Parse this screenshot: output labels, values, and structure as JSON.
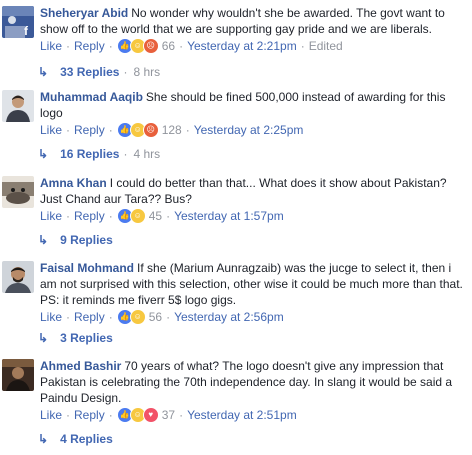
{
  "comments": [
    {
      "author": "Sheheryar Abid",
      "text": "No wonder why wouldn't she be awarded. The govt want to show off to the world that we are supporting gay pride and we are liberals.",
      "like": "Like",
      "reply": "Reply",
      "reaction_count": "66",
      "timestamp": "Yesterday at 2:21pm",
      "edited": "Edited",
      "replies": "33 Replies",
      "replies_time": "8 hrs"
    },
    {
      "author": "Muhammad Aaqib",
      "text": "She should be fined 500,000 instead of awarding for this logo",
      "like": "Like",
      "reply": "Reply",
      "reaction_count": "128",
      "timestamp": "Yesterday at 2:25pm",
      "replies": "16 Replies",
      "replies_time": "4 hrs"
    },
    {
      "author": "Amna Khan",
      "text": "I could do better than that... What does it show about Pakistan? Just Chand aur Tara?? Bus?",
      "like": "Like",
      "reply": "Reply",
      "reaction_count": "45",
      "timestamp": "Yesterday at 1:57pm",
      "replies": "9 Replies"
    },
    {
      "author": "Faisal Mohmand",
      "text": "If she (Marium Aunragzaib) was the jucge to select it, then i am not surprised with this selection, other wise it could be much more than that. PS: it reminds me fiverr 5$ logo gigs.",
      "like": "Like",
      "reply": "Reply",
      "reaction_count": "56",
      "timestamp": "Yesterday at 2:56pm",
      "replies": "3 Replies"
    },
    {
      "author": "Ahmed Bashir",
      "text": "70 years of what? The logo doesn't give any impression that Pakistan is celebrating the 70th independence day. In slang it would be said a Paindu Design.",
      "like": "Like",
      "reply": "Reply",
      "reaction_count": "37",
      "timestamp": "Yesterday at 2:51pm",
      "replies": "4 Replies"
    }
  ],
  "icons": {
    "replies_arrow": "reply-arrow-icon",
    "like_reaction": "like-reaction-icon",
    "haha_reaction": "haha-reaction-icon",
    "angry_reaction": "angry-reaction-icon",
    "love_reaction": "love-reaction-icon"
  },
  "colors": {
    "author": "#365899",
    "link": "#4267b2",
    "meta": "#90949c",
    "text": "#1d2129"
  }
}
